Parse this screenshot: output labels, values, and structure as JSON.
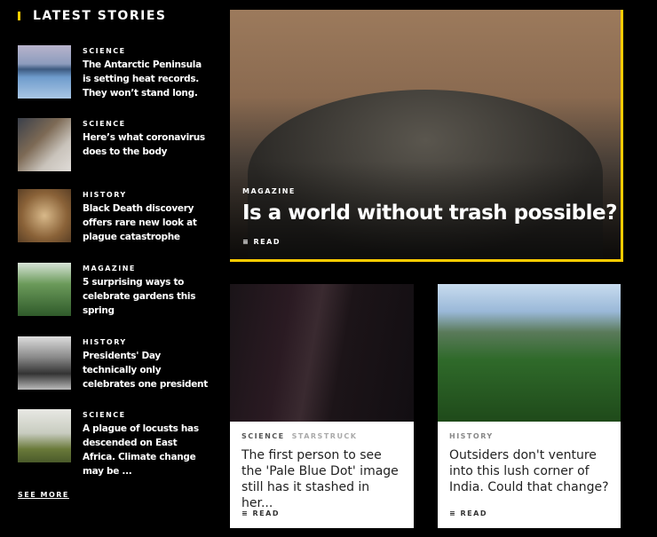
{
  "sidebar": {
    "title": "LATEST STORIES",
    "see_more": "SEE MORE",
    "items": [
      {
        "category": "SCIENCE",
        "title": "The Antarctic Peninsula is setting heat records. They won’t stand long."
      },
      {
        "category": "SCIENCE",
        "title": "Here’s what coronavirus does to the body"
      },
      {
        "category": "HISTORY",
        "title": "Black Death discovery offers rare new look at plague catastrophe"
      },
      {
        "category": "MAGAZINE",
        "title": "5 surprising ways to celebrate gardens this spring"
      },
      {
        "category": "HISTORY",
        "title": "Presidents' Day technically only celebrates one president"
      },
      {
        "category": "SCIENCE",
        "title": "A plague of locusts has descended on East Africa. Climate change may be ..."
      }
    ]
  },
  "hero": {
    "category": "MAGAZINE",
    "title": "Is a world without trash possible?",
    "read": "READ",
    "icon": "list-icon"
  },
  "cards": [
    {
      "category": "SCIENCE",
      "subcategory": "STARSTRUCK",
      "title": "The first person to see the 'Pale Blue Dot' image still has it stashed in her...",
      "read": "READ"
    },
    {
      "category": "HISTORY",
      "title": "Outsiders don't venture into this lush corner of India. Could that change?",
      "read": "READ"
    }
  ],
  "colors": {
    "accent": "#ffcc00"
  }
}
